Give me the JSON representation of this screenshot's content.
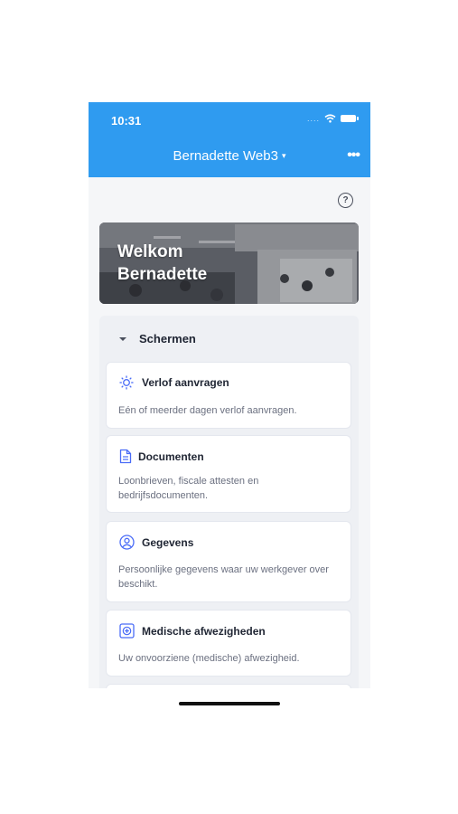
{
  "status_bar": {
    "time": "10:31",
    "signal": "....",
    "wifi_icon": "wifi-icon",
    "battery_icon": "battery-icon"
  },
  "header": {
    "title": "Bernadette Web3",
    "caret": "▾",
    "more": "•••",
    "color": "#2f9bf0"
  },
  "help": {
    "label": "?"
  },
  "banner": {
    "line1": "Welkom",
    "line2": "Bernadette"
  },
  "section": {
    "title": "Schermen"
  },
  "items": [
    {
      "icon": "sun-icon",
      "title": "Verlof aanvragen",
      "desc": "Eén of meerder dagen verlof aanvragen."
    },
    {
      "icon": "document-icon",
      "title": "Documenten",
      "desc": "Loonbrieven, fiscale attesten en bedrijfsdocumenten."
    },
    {
      "icon": "person-icon",
      "title": "Gegevens",
      "desc": "Persoonlijke gegevens waar uw werkgever over beschikt."
    },
    {
      "icon": "medical-icon",
      "title": "Medische afwezigheden",
      "desc": "Uw onvoorziene (medische) afwezigheid."
    }
  ],
  "accent_color": "#4a6cf7"
}
